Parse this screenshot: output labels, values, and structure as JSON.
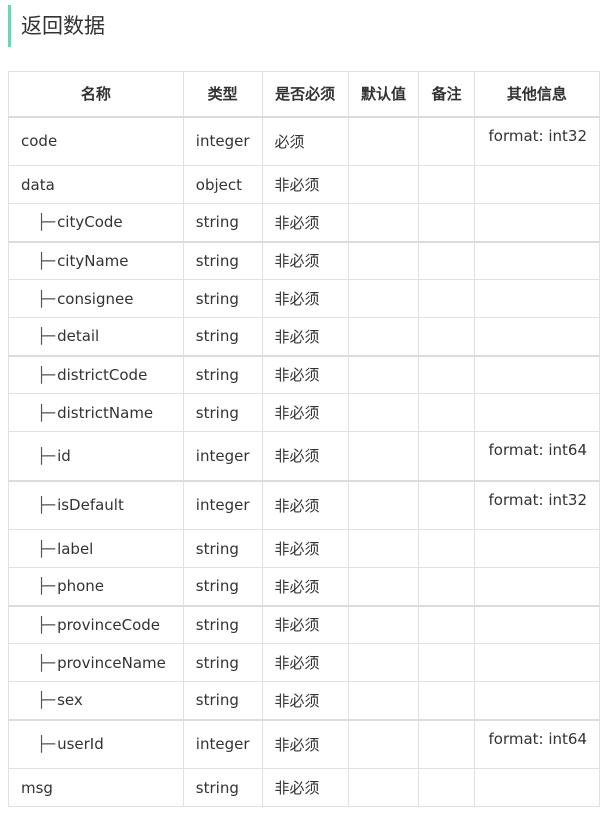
{
  "title": "返回数据",
  "headers": [
    "名称",
    "类型",
    "是否必须",
    "默认值",
    "备注",
    "其他信息"
  ],
  "tree_prefix": "├─",
  "rows": [
    {
      "name": "code",
      "type": "integer",
      "required": "必须",
      "default": "",
      "note": "",
      "other": "format: int32",
      "child": false
    },
    {
      "name": "data",
      "type": "object",
      "required": "非必须",
      "default": "",
      "note": "",
      "other": "",
      "child": false
    },
    {
      "name": "cityCode",
      "type": "string",
      "required": "非必须",
      "default": "",
      "note": "",
      "other": "",
      "child": true
    },
    {
      "name": "cityName",
      "type": "string",
      "required": "非必须",
      "default": "",
      "note": "",
      "other": "",
      "child": true
    },
    {
      "name": "consignee",
      "type": "string",
      "required": "非必须",
      "default": "",
      "note": "",
      "other": "",
      "child": true
    },
    {
      "name": "detail",
      "type": "string",
      "required": "非必须",
      "default": "",
      "note": "",
      "other": "",
      "child": true
    },
    {
      "name": "districtCode",
      "type": "string",
      "required": "非必须",
      "default": "",
      "note": "",
      "other": "",
      "child": true
    },
    {
      "name": "districtName",
      "type": "string",
      "required": "非必须",
      "default": "",
      "note": "",
      "other": "",
      "child": true
    },
    {
      "name": "id",
      "type": "integer",
      "required": "非必须",
      "default": "",
      "note": "",
      "other": "format: int64",
      "child": true
    },
    {
      "name": "isDefault",
      "type": "integer",
      "required": "非必须",
      "default": "",
      "note": "",
      "other": "format: int32",
      "child": true
    },
    {
      "name": "label",
      "type": "string",
      "required": "非必须",
      "default": "",
      "note": "",
      "other": "",
      "child": true
    },
    {
      "name": "phone",
      "type": "string",
      "required": "非必须",
      "default": "",
      "note": "",
      "other": "",
      "child": true
    },
    {
      "name": "provinceCode",
      "type": "string",
      "required": "非必须",
      "default": "",
      "note": "",
      "other": "",
      "child": true
    },
    {
      "name": "provinceName",
      "type": "string",
      "required": "非必须",
      "default": "",
      "note": "",
      "other": "",
      "child": true
    },
    {
      "name": "sex",
      "type": "string",
      "required": "非必须",
      "default": "",
      "note": "",
      "other": "",
      "child": true
    },
    {
      "name": "userId",
      "type": "integer",
      "required": "非必须",
      "default": "",
      "note": "",
      "other": "format: int64",
      "child": true
    },
    {
      "name": "msg",
      "type": "string",
      "required": "非必须",
      "default": "",
      "note": "",
      "other": "",
      "child": false
    }
  ]
}
